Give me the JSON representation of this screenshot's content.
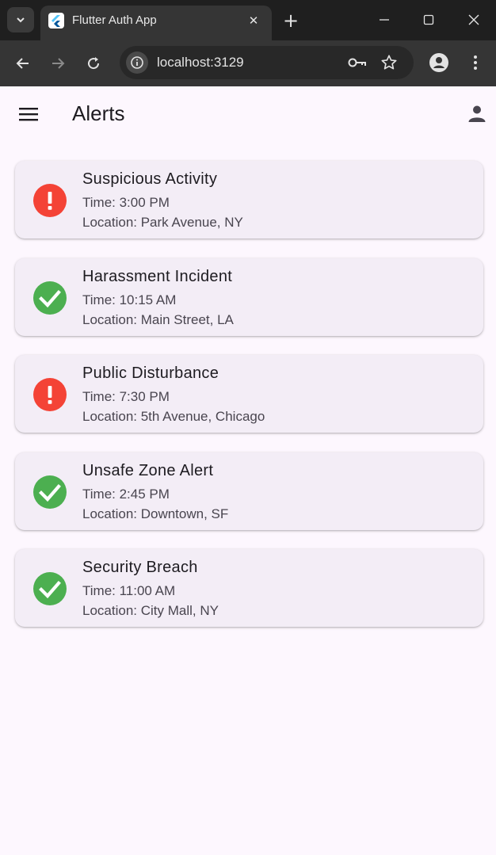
{
  "browser": {
    "tab_title": "Flutter Auth App",
    "url": "localhost:3129",
    "tab_close_glyph": "✕",
    "new_tab_glyph": "+"
  },
  "app": {
    "title": "Alerts",
    "menu_icon": "hamburger-menu-icon",
    "account_icon": "person-icon"
  },
  "colors": {
    "error": "#f44336",
    "ok": "#4caf50",
    "card_bg": "#f3edf6",
    "page_bg": "#fdf7fe"
  },
  "alerts": [
    {
      "title": "Suspicious Activity",
      "time": "Time: 3:00 PM",
      "location": "Location: Park Avenue, NY",
      "status": "error",
      "icon": "exclamation-icon"
    },
    {
      "title": "Harassment Incident",
      "time": "Time: 10:15 AM",
      "location": "Location: Main Street, LA",
      "status": "ok",
      "icon": "check-icon"
    },
    {
      "title": "Public Disturbance",
      "time": "Time: 7:30 PM",
      "location": "Location: 5th Avenue, Chicago",
      "status": "error",
      "icon": "exclamation-icon"
    },
    {
      "title": "Unsafe Zone Alert",
      "time": "Time: 2:45 PM",
      "location": "Location: Downtown, SF",
      "status": "ok",
      "icon": "check-icon"
    },
    {
      "title": "Security Breach",
      "time": "Time: 11:00 AM",
      "location": "Location: City Mall, NY",
      "status": "ok",
      "icon": "check-icon"
    }
  ]
}
